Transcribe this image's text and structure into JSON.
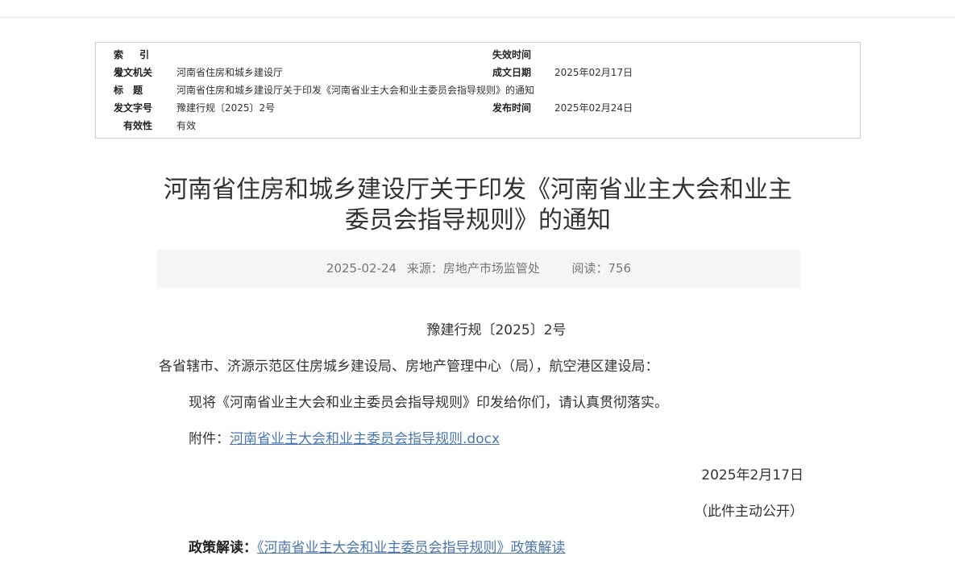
{
  "meta": {
    "index_label": "索 引 号",
    "index_value": "",
    "expire_label": "失效时间",
    "expire_value": "",
    "issuer_label": "发文机关",
    "issuer_value": "河南省住房和城乡建设厅",
    "made_label": "成文日期",
    "made_value": "2025年02月17日",
    "title_label": "标　题",
    "title_value": "河南省住房和城乡建设厅关于印发《河南省业主大会和业主委员会指导规则》的通知",
    "docno_label": "发文字号",
    "docno_value": "豫建行规〔2025〕2号",
    "publish_label": "发布时间",
    "publish_value": "2025年02月24日",
    "valid_label": "有效性",
    "valid_value": "有效"
  },
  "article": {
    "title_line1": "河南省住房和城乡建设厅关于印发《河南省业主大会和业主",
    "title_line2": "委员会指导规则》的通知",
    "date": "2025-02-24",
    "source": "来源：房地产市场监管处",
    "reads": "阅读：756",
    "doc_number": "豫建行规〔2025〕2号",
    "recipients": "各省辖市、济源示范区住房城乡建设局、房地产管理中心（局），航空港区建设局：",
    "body": "现将《河南省业主大会和业主委员会指导规则》印发给你们，请认真贯彻落实。",
    "attachment_label": "附件：",
    "attachment_link": "河南省业主大会和业主委员会指导规则.docx",
    "sign_date": "2025年2月17日",
    "disclosure": "（此件主动公开）",
    "interpretation_label": "政策解读：",
    "interpretation_link": "《河南省业主大会和业主委员会指导规则》政策解读"
  }
}
